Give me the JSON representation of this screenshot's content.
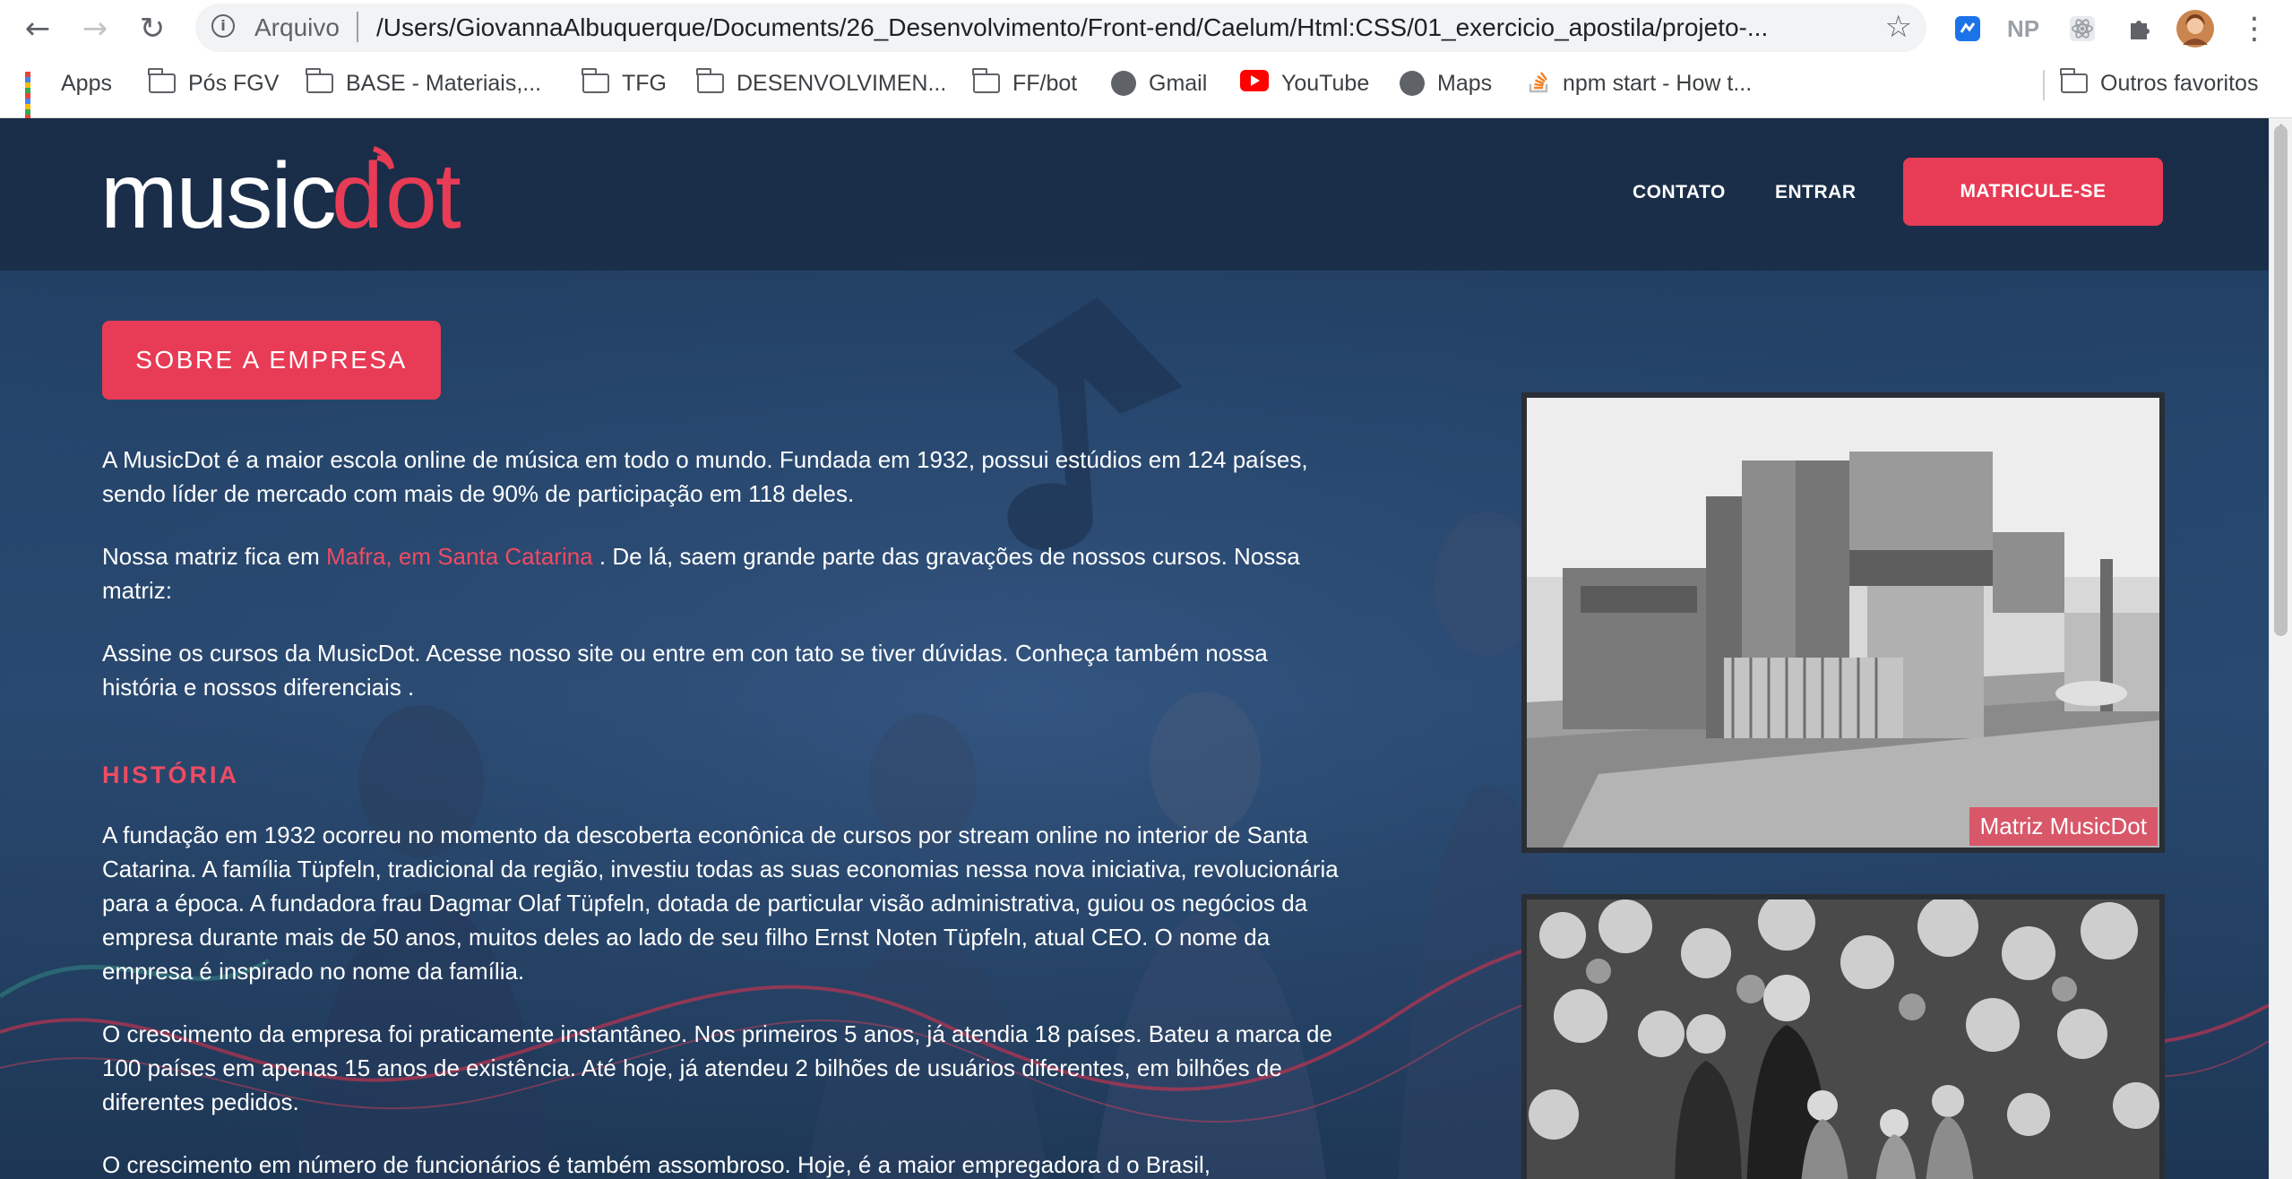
{
  "browser": {
    "scheme_label": "Arquivo",
    "url": "/Users/GiovannaAlbuquerque/Documents/26_Desenvolvimento/Front-end/Caelum/Html:CSS/01_exercicio_apostila/projeto-...",
    "extensions": [
      "extension-icon",
      "np-extension-icon",
      "react-extension-icon",
      "puzzle-extensions-icon",
      "profile-avatar",
      "menu-kebab-icon"
    ],
    "bookmarks": [
      {
        "label": "Apps",
        "icon": "apps-grid-icon"
      },
      {
        "label": "Pós FGV",
        "icon": "folder-icon"
      },
      {
        "label": "BASE - Materiais,...",
        "icon": "folder-icon"
      },
      {
        "label": "TFG",
        "icon": "folder-icon"
      },
      {
        "label": "DESENVOLVIMEN...",
        "icon": "folder-icon"
      },
      {
        "label": "FF/bot",
        "icon": "folder-icon"
      },
      {
        "label": "Gmail",
        "icon": "globe-icon"
      },
      {
        "label": "YouTube",
        "icon": "youtube-icon"
      },
      {
        "label": "Maps",
        "icon": "globe-icon"
      },
      {
        "label": "npm start - How t...",
        "icon": "stackoverflow-icon"
      }
    ],
    "other_bookmarks": "Outros favoritos"
  },
  "site": {
    "logo_text": "musicdot",
    "nav": {
      "contato": "CONTATO",
      "entrar": "ENTRAR",
      "cta": "MATRICULE-SE"
    },
    "badge": "SOBRE A EMPRESA",
    "intro": {
      "p1": "A MusicDot é a maior escola online de música em todo o mundo. Fundada em 1932, possui estúdios em 124 países, sendo líder de mercado com mais de 90% de participação em 118 deles.",
      "p2_before": "Nossa matriz fica em ",
      "p2_link": "Mafra, em Santa Catarina",
      "p2_after": " . De lá, saem grande parte das gravações de nossos cursos. Nossa matriz:",
      "p3": "Assine os cursos da MusicDot. Acesse nosso site ou entre em con tato se tiver dúvidas. Conheça também nossa história e nossos diferenciais ."
    },
    "history": {
      "title": "HISTÓRIA",
      "p1": "A fundação em 1932 ocorreu no momento da descoberta econônica de cursos por stream online no interior de Santa Catarina. A família Tüpfeln, tradicional da região, investiu todas as suas economias nessa nova iniciativa, revolucionária para a época. A fundadora frau Dagmar Olaf Tüpfeln, dotada de particular visão administrativa, guiou os negócios da empresa durante mais de 50 anos, muitos deles ao lado de seu filho Ernst Noten Tüpfeln, atual CEO. O nome da empresa é inspirado no nome da família.",
      "p2": "O crescimento da empresa foi praticamente instantâneo. Nos primeiros 5 anos, já atendia 18 países. Bateu a marca de 100 países em apenas 15 anos de existência. Até hoje, já atendeu 2 bilhões de usuários diferentes, em bilhões de diferentes pedidos.",
      "p3": "O crescimento em número de funcionários é também assombroso. Hoje, é a maior empregadora d o Brasil,"
    },
    "photos": {
      "caption_1": "Matriz MusicDot"
    },
    "colors": {
      "accent": "#e83b55",
      "link": "#ef4b63",
      "background": "#26466d"
    }
  }
}
